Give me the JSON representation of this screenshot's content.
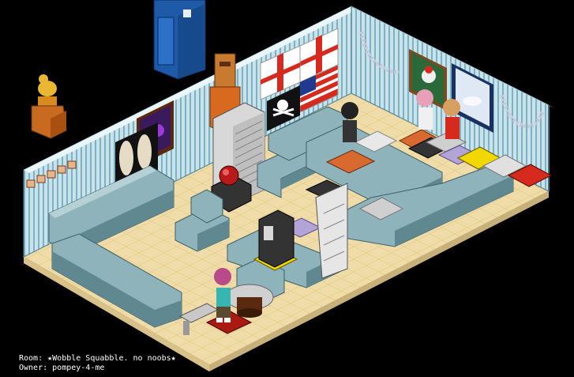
{
  "room": {
    "name_label": "Room:",
    "name": "★Wobble Squabble. no noobs★",
    "owner_label": "Owner:",
    "owner": "pompey-4-me"
  },
  "colors": {
    "background": "#000000",
    "wall_stripe_light": "#c9e3ea",
    "wall_stripe_dark": "#7fb1c4",
    "floor": "#f0dca8",
    "floor_line": "#e3cd92",
    "sofa": "#8eb3bb",
    "sofa_dark": "#5f8891",
    "accent_red": "#d62a1e",
    "accent_yellow": "#f0d800",
    "accent_purple": "#b3a4d8"
  },
  "icons": [
    "trophy-duck-icon",
    "portable-toilet-icon",
    "totem-statue-icon",
    "england-flag-icon",
    "usa-flag-icon",
    "pirate-flag-icon",
    "plasma-lamp-icon",
    "arcade-machine-icon",
    "avatar-icon"
  ]
}
